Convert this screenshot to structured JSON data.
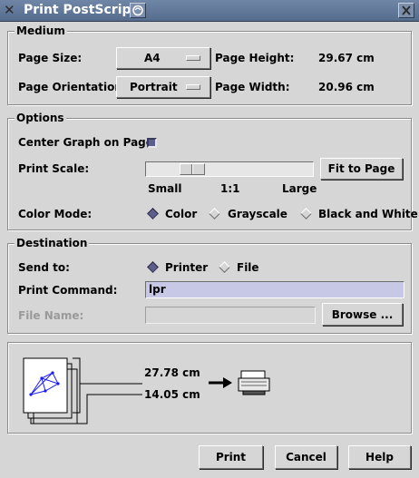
{
  "window": {
    "title": "Print PostScript"
  },
  "medium": {
    "heading": "Medium",
    "page_size_label": "Page Size:",
    "page_size_value": "A4",
    "page_height_label": "Page Height:",
    "page_height_value": "29.67 cm",
    "orientation_label": "Page Orientation:",
    "orientation_value": "Portrait",
    "page_width_label": "Page Width:",
    "page_width_value": "20.96 cm"
  },
  "options": {
    "heading": "Options",
    "center_label": "Center Graph on Page:",
    "center_checked": true,
    "scale_label": "Print Scale:",
    "scale_small": "Small",
    "scale_mid": "1:1",
    "scale_large": "Large",
    "fit_button": "Fit to Page",
    "color_mode_label": "Color Mode:",
    "color_options": [
      "Color",
      "Grayscale",
      "Black and White"
    ],
    "color_selected": "Color"
  },
  "destination": {
    "heading": "Destination",
    "send_to_label": "Send to:",
    "send_options": [
      "Printer",
      "File"
    ],
    "send_selected": "Printer",
    "print_command_label": "Print Command:",
    "print_command_value": "lpr",
    "file_name_label": "File Name:",
    "file_name_value": "",
    "browse_button": "Browse ..."
  },
  "preview": {
    "height_value": "27.78 cm",
    "width_value": "14.05 cm"
  },
  "actions": {
    "print": "Print",
    "cancel": "Cancel",
    "help": "Help"
  },
  "colors": {
    "titlebar": "#6f86a6",
    "background": "#d6d6d6",
    "entry_active": "#c6c8e6",
    "selected_indicator": "#5b5f8e"
  }
}
